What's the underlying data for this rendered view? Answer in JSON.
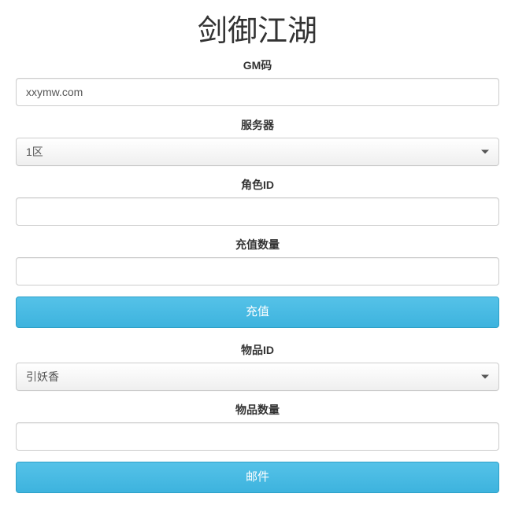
{
  "title": "剑御江湖",
  "labels": {
    "gm_code": "GM码",
    "server": "服务器",
    "role_id": "角色ID",
    "recharge_qty": "充值数量",
    "item_id": "物品ID",
    "item_qty": "物品数量"
  },
  "values": {
    "gm_code": "xxymw.com",
    "server_selected": "1区",
    "role_id": "",
    "recharge_qty": "",
    "item_selected": "引妖香",
    "item_qty": ""
  },
  "buttons": {
    "recharge": "充值",
    "mail": "邮件"
  }
}
